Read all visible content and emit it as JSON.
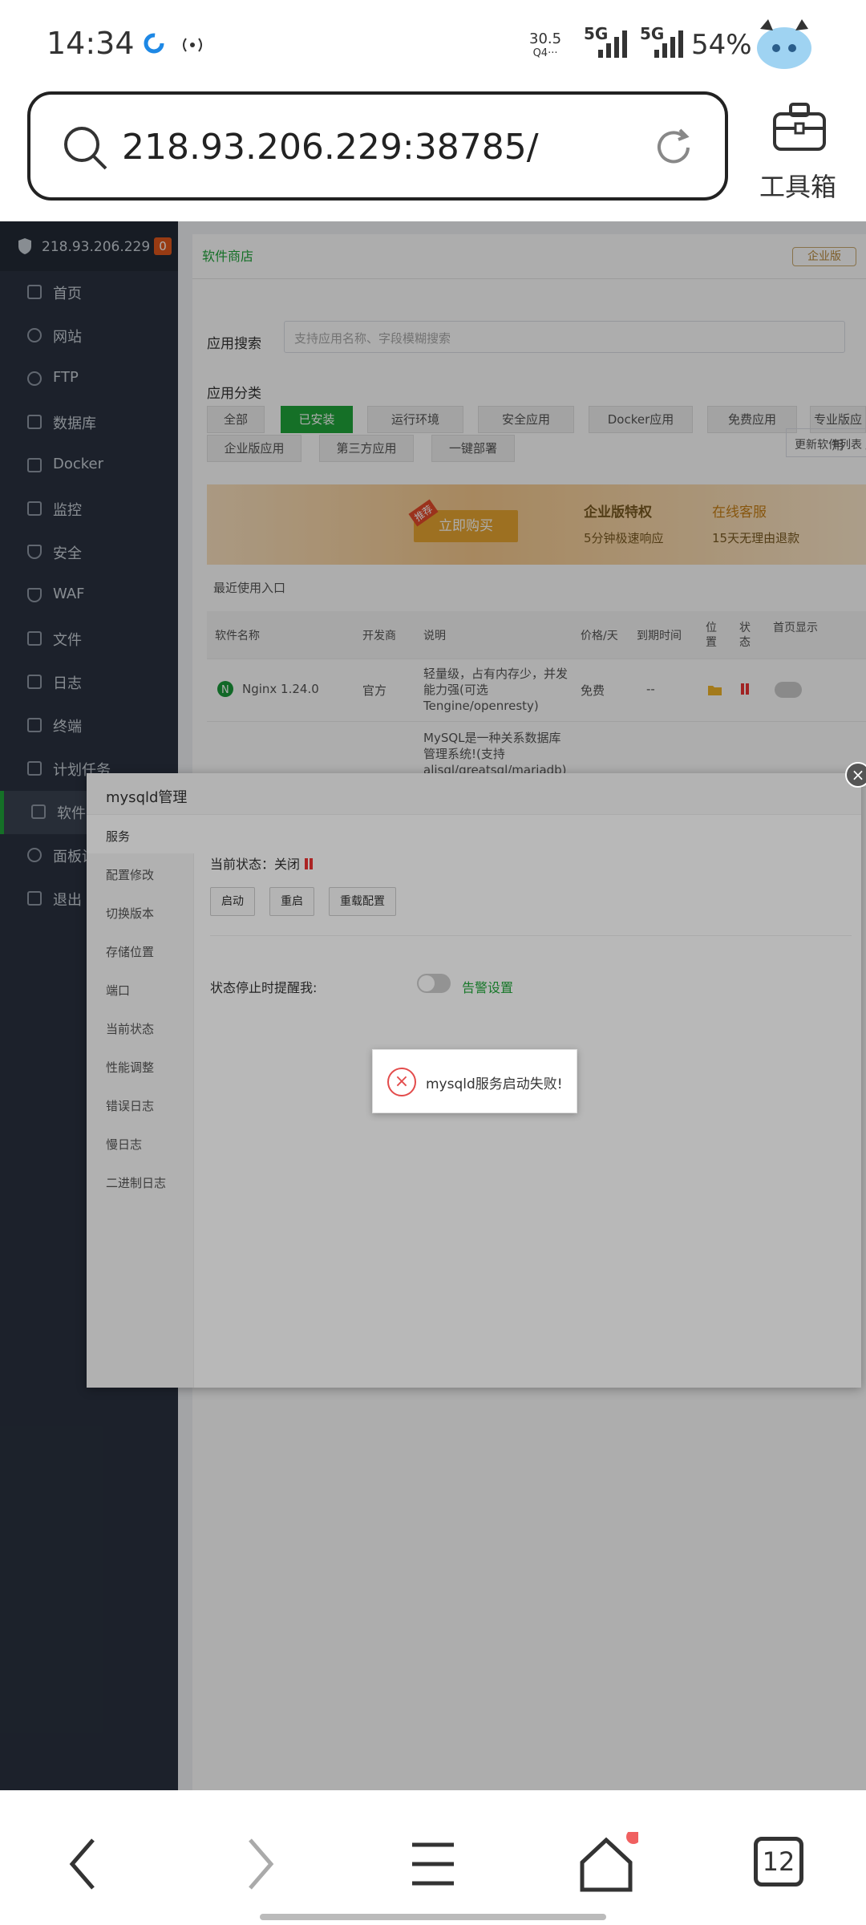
{
  "status_bar": {
    "time": "14:34",
    "net_speed_top": "30.5",
    "net_speed_bottom": "Q4···",
    "sig1": "5G",
    "sig2": "5G",
    "battery": "54%"
  },
  "browser": {
    "url": "218.93.206.229:38785/",
    "toolbox_label": "工具箱"
  },
  "sidebar": {
    "server_ip": "218.93.206.229",
    "alert_count": "0",
    "items": [
      {
        "label": "首页",
        "icon": "home-icon"
      },
      {
        "label": "网站",
        "icon": "globe-icon"
      },
      {
        "label": "FTP",
        "icon": "ftp-icon"
      },
      {
        "label": "数据库",
        "icon": "database-icon"
      },
      {
        "label": "Docker",
        "icon": "docker-icon"
      },
      {
        "label": "监控",
        "icon": "monitor-icon"
      },
      {
        "label": "安全",
        "icon": "shield-icon"
      },
      {
        "label": "WAF",
        "icon": "waf-icon"
      },
      {
        "label": "文件",
        "icon": "folder-icon"
      },
      {
        "label": "日志",
        "icon": "log-icon"
      },
      {
        "label": "终端",
        "icon": "terminal-icon"
      },
      {
        "label": "计划任务",
        "icon": "clock-icon"
      },
      {
        "label": "软件商店",
        "icon": "grid-icon"
      },
      {
        "label": "面板设置",
        "icon": "gear-icon"
      },
      {
        "label": "退出",
        "icon": "logout-icon"
      }
    ]
  },
  "store": {
    "tab": "软件商店",
    "enterprise_badge": "企业版",
    "search_label": "应用搜索",
    "search_placeholder": "支持应用名称、字段模糊搜索",
    "category_label": "应用分类",
    "categories": [
      "全部",
      "已安装",
      "运行环境",
      "安全应用",
      "Docker应用",
      "免费应用",
      "专业版应用",
      "企业版应用",
      "第三方应用",
      "一键部署"
    ],
    "update_btn": "更新软件列表 / 支",
    "banner": {
      "tag": "推荐",
      "buy": "立即购买",
      "feat1": "企业版特权",
      "feat2": "在线客服",
      "feat3": "5分钟极速响应",
      "feat4": "15天无理由退款"
    },
    "recent_label": "最近使用入口",
    "table_headers": [
      "软件名称",
      "开发商",
      "说明",
      "价格/天",
      "到期时间",
      "位置",
      "状态",
      "首页显示"
    ],
    "rows": [
      {
        "name": "Nginx 1.24.0",
        "dev": "官方",
        "desc": "轻量级，占有内存少，并发能力强(可选Tengine/openresty)",
        "price": "免费",
        "expire": "--"
      },
      {
        "name": "",
        "dev": "",
        "desc": "MySQL是一种关系数据库管理系统!(支持alisql/greatsql/mariadb)",
        "price": "",
        "expire": ""
      }
    ]
  },
  "modal": {
    "title": "mysqld管理",
    "nav": [
      "服务",
      "配置修改",
      "切换版本",
      "存储位置",
      "端口",
      "当前状态",
      "性能调整",
      "错误日志",
      "慢日志",
      "二进制日志"
    ],
    "state_label": "当前状态：",
    "state_value": "关闭",
    "buttons": [
      "启动",
      "重启",
      "重载配置"
    ],
    "remind_label": "状态停止时提醒我:",
    "alert_link": "告警设置"
  },
  "toast": {
    "message": "mysqld服务启动失败!"
  },
  "bottom_nav": {
    "tabs_count": "12"
  }
}
